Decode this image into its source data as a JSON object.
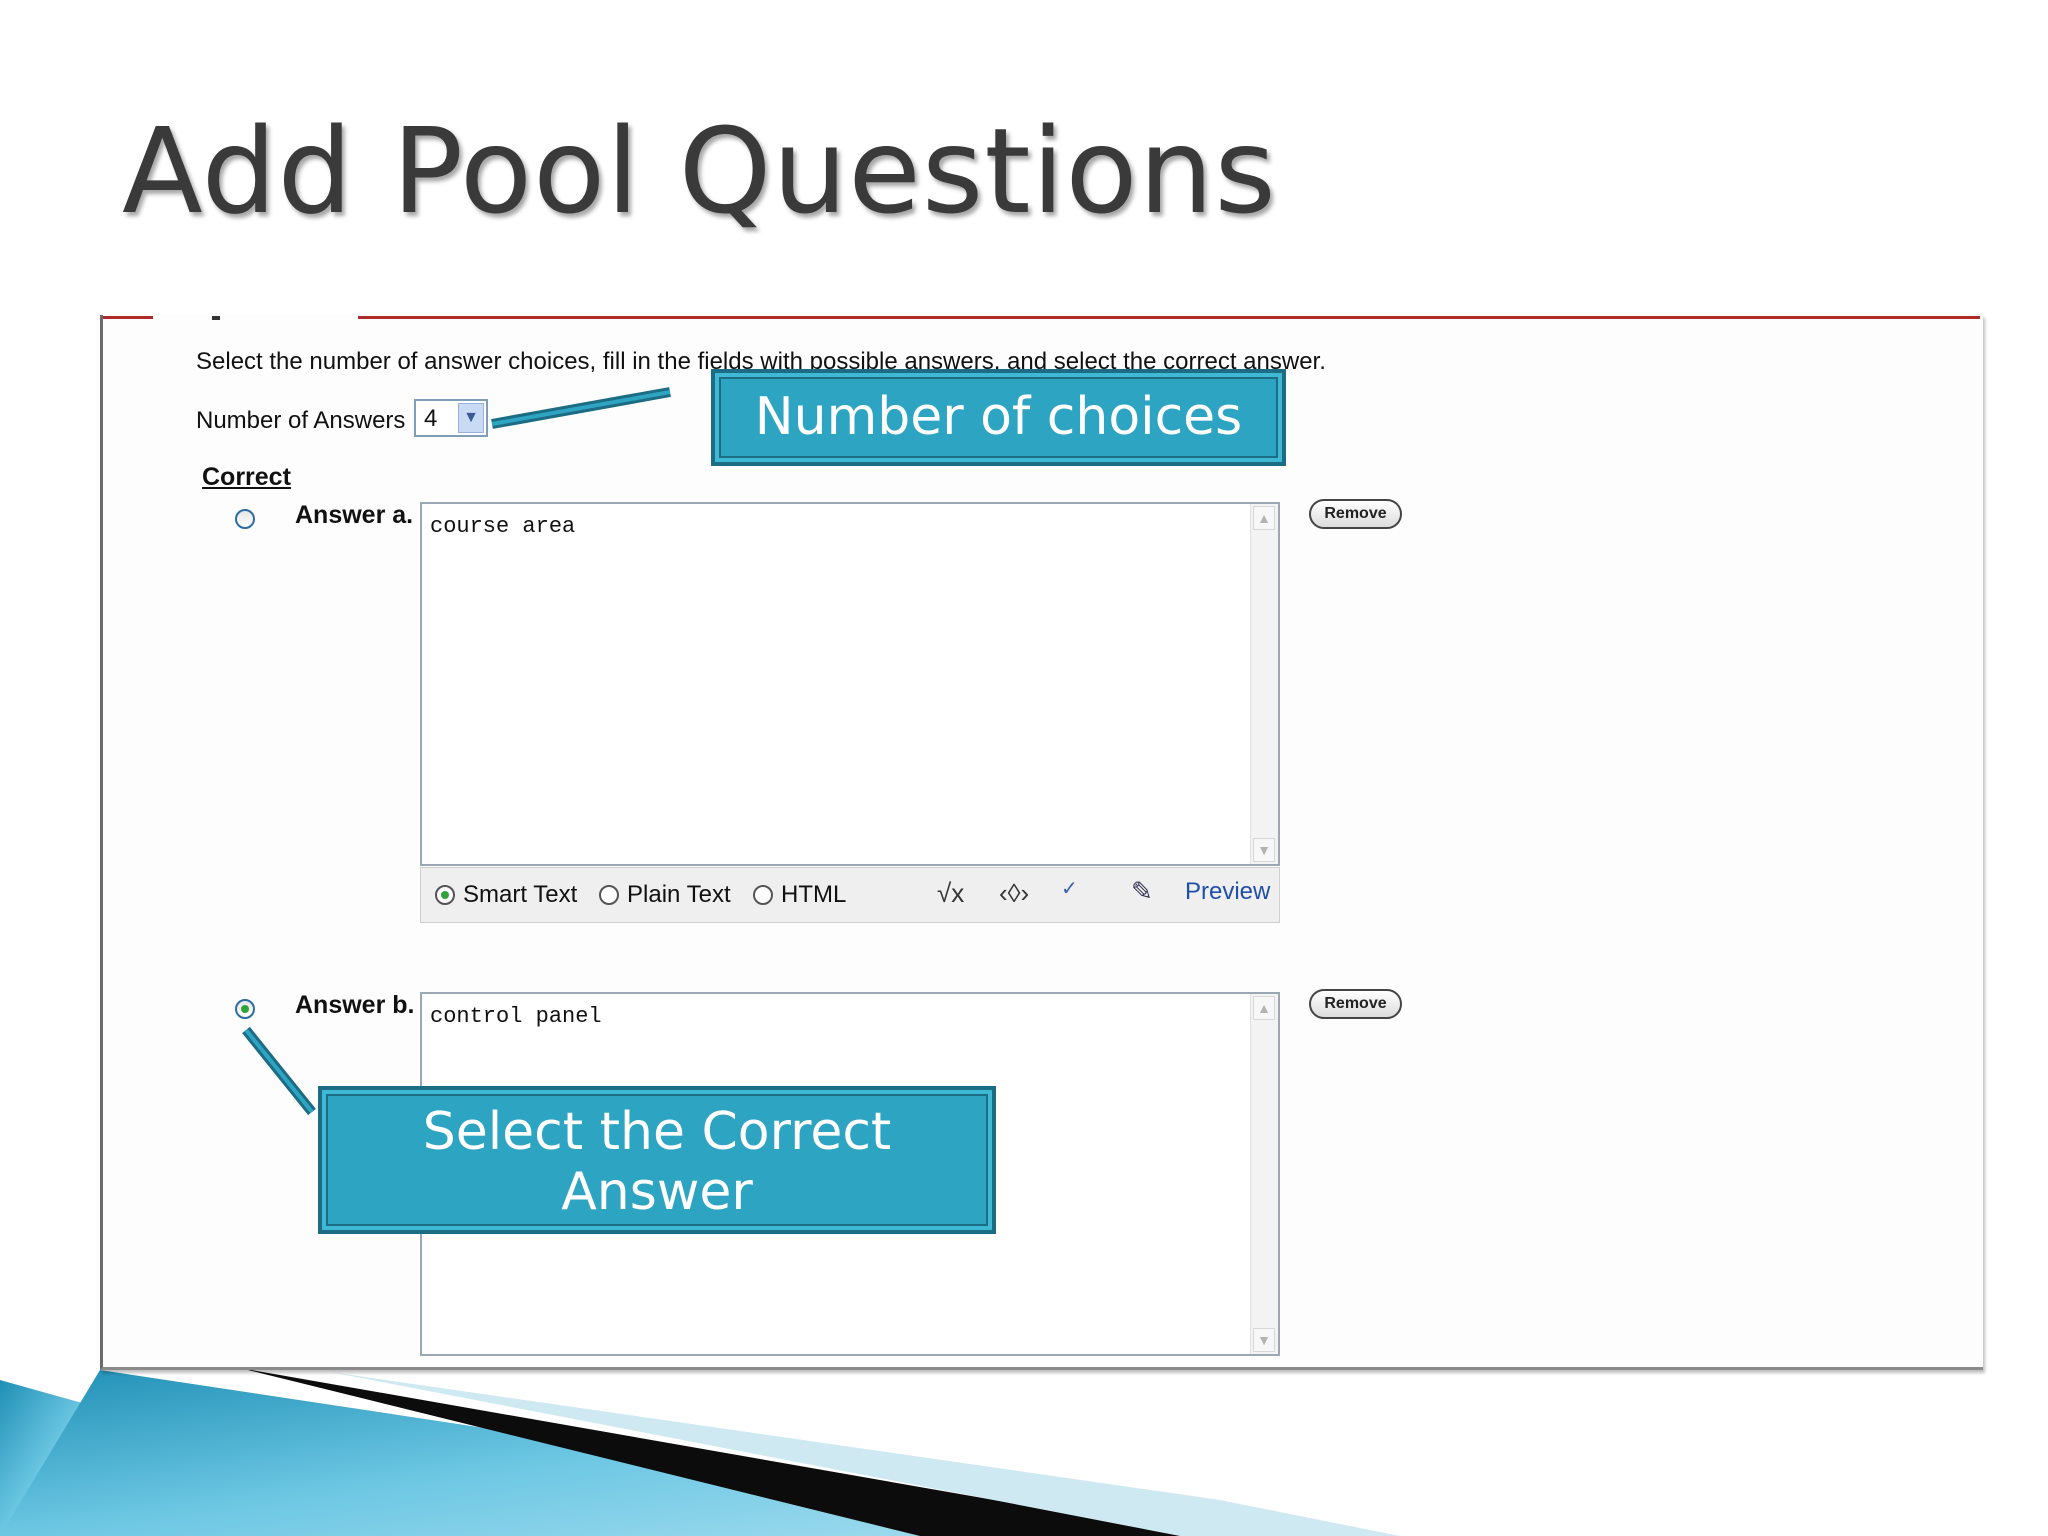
{
  "slide": {
    "title": "Add Pool Questions"
  },
  "form": {
    "instructions": "Select the number of answer choices, fill in the fields with possible answers, and select the correct answer.",
    "number_of_answers_label": "Number of Answers",
    "number_of_answers_value": "4",
    "correct_header": "Correct",
    "answers": [
      {
        "label": "Answer a.",
        "text": "course area",
        "selected": false,
        "remove_label": "Remove"
      },
      {
        "label": "Answer b.",
        "text": "control panel",
        "selected": true,
        "remove_label": "Remove"
      }
    ],
    "editor_options": {
      "smart_text": "Smart Text",
      "plain_text": "Plain Text",
      "html": "HTML",
      "selected": "Smart Text",
      "preview": "Preview"
    }
  },
  "callouts": {
    "choices": "Number of choices",
    "correct": "Select the Correct Answer"
  },
  "colors": {
    "callout_fill": "#2ea4c3",
    "callout_border": "#1c6c84",
    "accent_rule": "#b02a2a",
    "title_text": "#3a3a3a"
  }
}
